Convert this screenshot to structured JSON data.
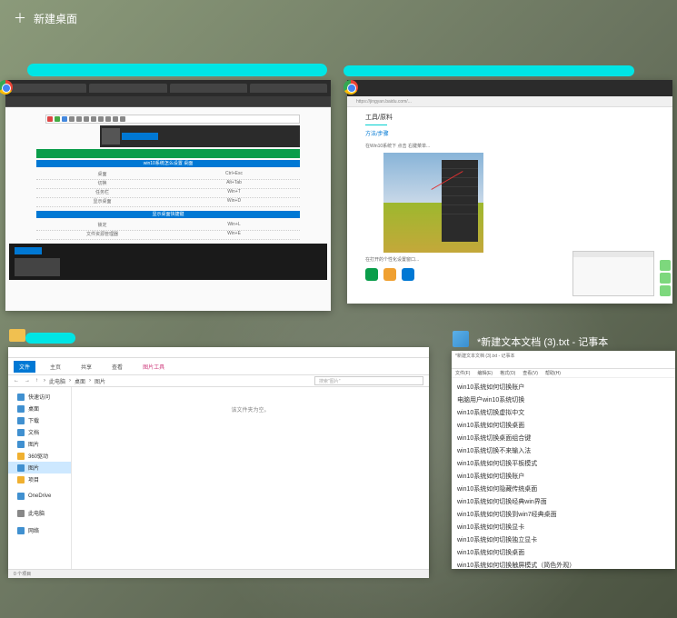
{
  "newDesktopLabel": "新建桌面",
  "win1": {
    "blueRowText": "win10系统怎么设置 桌面",
    "tableRows": [
      [
        "桌面",
        "Ctrl+Esc"
      ],
      [
        "切换",
        "Alt+Tab"
      ],
      [
        "任务栏",
        "Win+T"
      ],
      [
        "显示桌面",
        "Win+D"
      ],
      [
        "锁定",
        "Win+L"
      ],
      [
        "文件资源管理器",
        "Win+E"
      ]
    ],
    "blueRow2": "显示桌面快捷键"
  },
  "win2": {
    "address": "https://jingyan.baidu.com/...",
    "title": "工具/原料",
    "subtitle": "方法/步骤",
    "stepText": "在Win10系统下 点击 右键菜单...",
    "bottomText": "在打开的个性化设置窗口..."
  },
  "win3": {
    "ribbonTabs": {
      "file": "文件",
      "home": "主页",
      "share": "共享",
      "view": "查看",
      "imageTools": "图片工具"
    },
    "breadcrumb": [
      "此电脑",
      "桌面",
      "图片"
    ],
    "searchPlaceholder": "搜索\"图片\"",
    "sidebar": {
      "quickAccess": "快速访问",
      "desktop": "桌面",
      "downloads": "下载",
      "documents": "文档",
      "pictures": "图片",
      "videos": "360驱动",
      "pics2": "图片",
      "items": "项目",
      "oneDrive": "OneDrive",
      "thisPC": "此电脑",
      "network": "网络"
    },
    "emptyText": "该文件夹为空。",
    "statusText": "0 个项目"
  },
  "win4": {
    "title": "*新建文本文档 (3).txt - 记事本",
    "headerText": "*新建文本文档 (3).txt - 记事本",
    "menu": [
      "文件(F)",
      "编辑(E)",
      "格式(O)",
      "查看(V)",
      "帮助(H)"
    ],
    "lines": [
      "win10系统如何切换账户",
      "电脑用户win10系统切换",
      "win10系统切换虚拟中文",
      "win10系统如何切换桌面",
      "win10系统切换桌面组合键",
      "win10系统切换不来输入法",
      "win10系统如何切换平板模式",
      "win10系统如何切换账户",
      "",
      "win10系统如何隐藏传统桌面",
      "win10系统如何切换经典win界面",
      "win10系统如何切换到win7经典桌面",
      "win10系统如何切换显卡",
      "win10系统如何切换独立显卡",
      "win10系统如何切换桌面",
      "win10系统如何切换触屏模式（简色外观）"
    ]
  }
}
